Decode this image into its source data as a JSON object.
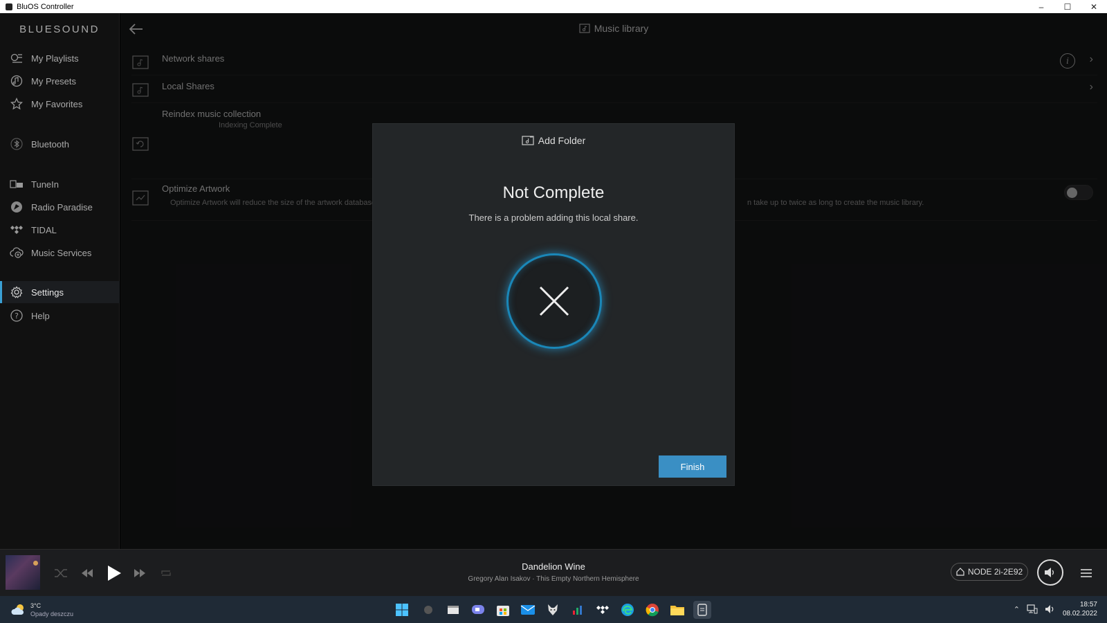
{
  "window": {
    "title": "BluOS Controller"
  },
  "sidebar": {
    "logo": "BLUESOUND",
    "items": [
      {
        "label": "My Playlists",
        "icon": "playlist-icon"
      },
      {
        "label": "My Presets",
        "icon": "preset-icon"
      },
      {
        "label": "My Favorites",
        "icon": "star-icon"
      },
      {
        "label": "Bluetooth",
        "icon": "bluetooth-icon"
      },
      {
        "label": "TuneIn",
        "icon": "tunein-icon"
      },
      {
        "label": "Radio Paradise",
        "icon": "radio-paradise-icon"
      },
      {
        "label": "TIDAL",
        "icon": "tidal-icon"
      },
      {
        "label": "Music Services",
        "icon": "music-services-icon"
      },
      {
        "label": "Settings",
        "icon": "gear-icon",
        "active": true
      },
      {
        "label": "Help",
        "icon": "help-icon"
      }
    ]
  },
  "main": {
    "title": "Music library",
    "rows": {
      "network": {
        "label": "Network shares"
      },
      "local": {
        "label": "Local Shares"
      },
      "reindex": {
        "label": "Reindex music collection",
        "status": "Indexing Complete"
      },
      "artwork": {
        "label": "Optimize Artwork",
        "desc_left": "Optimize Artwork will reduce the size of the artwork database",
        "desc_right": "n take up to twice as long to create the music library.",
        "enabled": false
      }
    }
  },
  "dialog": {
    "header": "Add Folder",
    "title": "Not Complete",
    "message": "There is a problem adding this local share.",
    "finish_label": "Finish"
  },
  "player": {
    "track_title": "Dandelion Wine",
    "track_sub": "Gregory Alan Isakov · This Empty Northern Hemisphere",
    "node": "NODE 2i-2E92"
  },
  "taskbar": {
    "weather_temp": "3°C",
    "weather_desc": "Opady deszczu",
    "time": "18:57",
    "date": "08.02.2022"
  },
  "colors": {
    "accent": "#3a8fc4",
    "glow": "#1a87b8"
  }
}
